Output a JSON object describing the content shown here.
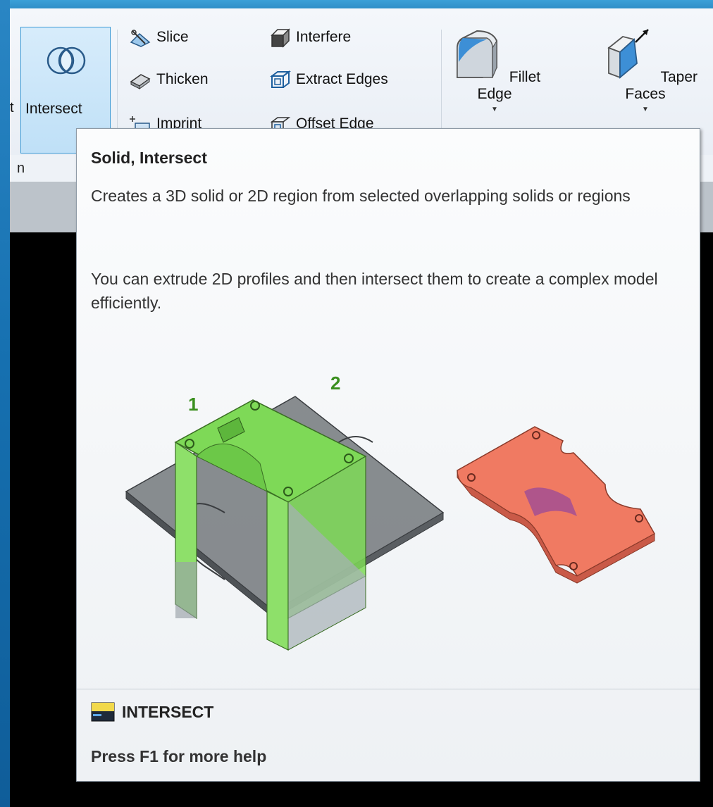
{
  "ribbon": {
    "cropped_left_label": "t",
    "intersect_label": "Intersect",
    "slice_label": "Slice",
    "thicken_label": "Thicken",
    "imprint_label": "Imprint",
    "interfere_label": "Interfere",
    "extract_edges_label": "Extract Edges",
    "offset_edge_label": "Offset Edge",
    "fillet_edge_label": "Fillet Edge",
    "taper_faces_label": "Taper Faces",
    "panel_label": "n",
    "dropdown_glyph": "▼"
  },
  "tooltip": {
    "title": "Solid, Intersect",
    "description": "Creates a 3D solid or 2D region from selected overlapping solids or regions",
    "more_info": "You can extrude 2D profiles and then intersect them to create a complex model efficiently.",
    "illustration_labels": [
      "1",
      "2"
    ],
    "command_name": "INTERSECT",
    "help_hint": "Press F1 for more help"
  },
  "colors": {
    "ribbon_bg": "#eef2f7",
    "selected_button": "#cfe6f8",
    "solid_1_green": "#7ed957",
    "solid_2_grey": "#6f7478",
    "result_orange": "#f07a62",
    "label_green": "#3a8f1e"
  },
  "icons": [
    "intersect-icon",
    "slice-icon",
    "thicken-icon",
    "imprint-icon",
    "interfere-icon",
    "extract-edges-icon",
    "offset-edge-icon",
    "fillet-edge-icon",
    "taper-faces-icon",
    "command-icon"
  ]
}
